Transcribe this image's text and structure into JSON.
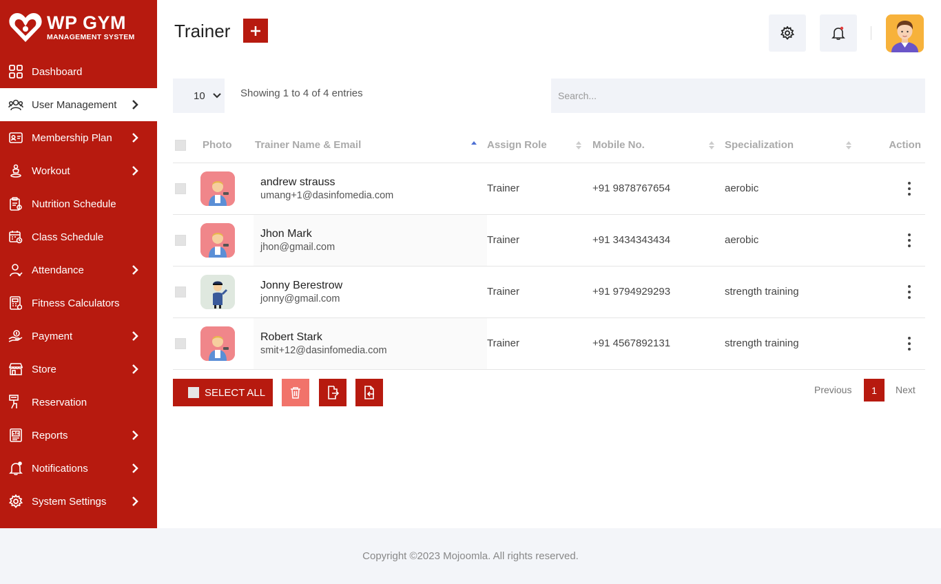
{
  "brand": {
    "name": "WP GYM",
    "tagline": "MANAGEMENT SYSTEM",
    "color": "#b71a0f"
  },
  "sidebar": {
    "items": [
      {
        "label": "Dashboard",
        "icon": "grid-icon",
        "chevron": false,
        "active": false
      },
      {
        "label": "User Management",
        "icon": "users-icon",
        "chevron": true,
        "active": true
      },
      {
        "label": "Membership Plan",
        "icon": "id-card-icon",
        "chevron": true,
        "active": false
      },
      {
        "label": "Workout",
        "icon": "workout-icon",
        "chevron": true,
        "active": false
      },
      {
        "label": "Nutrition Schedule",
        "icon": "clipboard-icon",
        "chevron": false,
        "active": false
      },
      {
        "label": "Class Schedule",
        "icon": "calendar-icon",
        "chevron": false,
        "active": false
      },
      {
        "label": "Attendance",
        "icon": "user-check-icon",
        "chevron": true,
        "active": false
      },
      {
        "label": "Fitness Calculators",
        "icon": "calculator-icon",
        "chevron": false,
        "active": false
      },
      {
        "label": "Payment",
        "icon": "payment-icon",
        "chevron": true,
        "active": false
      },
      {
        "label": "Store",
        "icon": "store-icon",
        "chevron": true,
        "active": false
      },
      {
        "label": "Reservation",
        "icon": "reservation-icon",
        "chevron": false,
        "active": false
      },
      {
        "label": "Reports",
        "icon": "report-icon",
        "chevron": true,
        "active": false
      },
      {
        "label": "Notifications",
        "icon": "bell-icon",
        "chevron": true,
        "active": false
      },
      {
        "label": "System Settings",
        "icon": "gear-icon",
        "chevron": true,
        "active": false
      }
    ]
  },
  "header": {
    "title": "Trainer"
  },
  "controls": {
    "page_length": "10",
    "info": "Showing 1 to 4 of 4 entries",
    "search_placeholder": "Search..."
  },
  "table": {
    "headers": {
      "photo": "Photo",
      "name_email": "Trainer Name & Email",
      "role": "Assign Role",
      "mobile": "Mobile No.",
      "specialization": "Specialization",
      "action": "Action"
    },
    "rows": [
      {
        "name": "andrew strauss",
        "email": "umang+1@dasinfomedia.com",
        "role": "Trainer",
        "mobile": "+91 9878767654",
        "specialization": "aerobic",
        "photo": "trainer-avatar"
      },
      {
        "name": "Jhon Mark",
        "email": "jhon@gmail.com",
        "role": "Trainer",
        "mobile": "+91 3434343434",
        "specialization": "aerobic",
        "photo": "trainer-avatar"
      },
      {
        "name": "Jonny Berestrow",
        "email": "jonny@gmail.com",
        "role": "Trainer",
        "mobile": "+91 9794929293",
        "specialization": "strength training",
        "photo": "police-avatar"
      },
      {
        "name": "Robert Stark",
        "email": "smit+12@dasinfomedia.com",
        "role": "Trainer",
        "mobile": "+91 4567892131",
        "specialization": "strength training",
        "photo": "trainer-avatar"
      }
    ]
  },
  "footer_actions": {
    "select_all": "SELECT ALL"
  },
  "pagination": {
    "previous": "Previous",
    "current": "1",
    "next": "Next"
  },
  "footer": {
    "copyright": "Copyright ©2023 Mojoomla. All rights reserved."
  }
}
